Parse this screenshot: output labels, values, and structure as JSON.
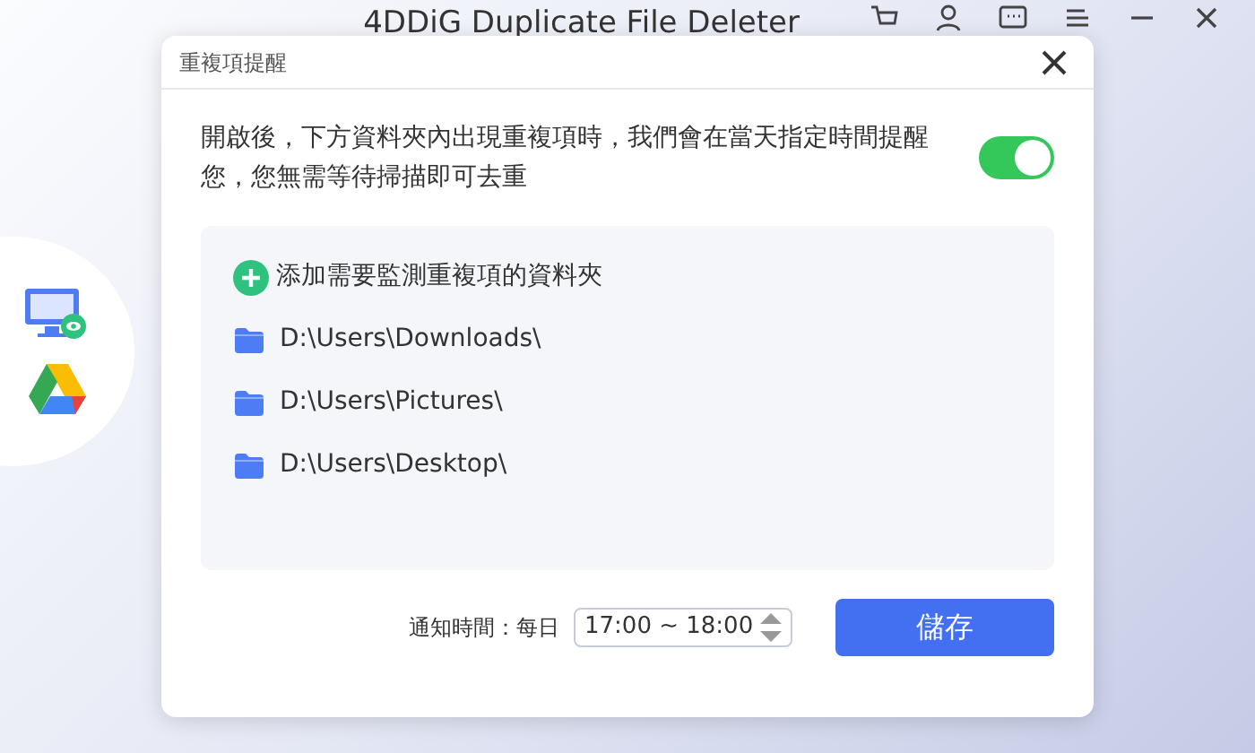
{
  "app": {
    "title": "4DDiG Duplicate File Deleter"
  },
  "dialog": {
    "title": "重複項提醒",
    "description": "開啟後，下方資料夾內出現重複項時，我們會在當天指定時間提醒您，您無需等待掃描即可去重",
    "reminder_on": true,
    "add_folder": "添加需要監測重複項的資料夾",
    "folders": [
      "D:\\Users\\Downloads\\",
      "D:\\Users\\Pictures\\",
      "D:\\Users\\Desktop\\"
    ],
    "notify_label": "通知時間：每日",
    "time_range": "17:00 ~ 18:00",
    "save": "儲存"
  }
}
